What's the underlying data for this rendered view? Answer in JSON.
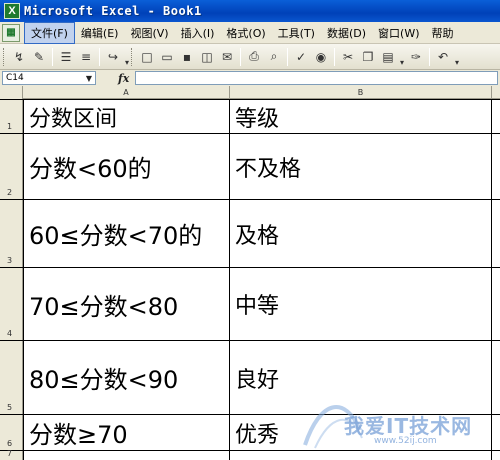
{
  "window": {
    "title": "Microsoft Excel - Book1"
  },
  "menubar": {
    "items": [
      "文件(F)",
      "编辑(E)",
      "视图(V)",
      "插入(I)",
      "格式(O)",
      "工具(T)",
      "数据(D)",
      "窗口(W)",
      "帮助"
    ]
  },
  "formula_bar": {
    "name_box": "C14",
    "fx_label": "fx",
    "formula": ""
  },
  "columns": [
    "A",
    "B"
  ],
  "rows": [
    {
      "num": "1",
      "a": "分数区间",
      "b": "等级"
    },
    {
      "num": "2",
      "a": "分数<60的",
      "b": "不及格"
    },
    {
      "num": "3",
      "a": "60≤分数<70的",
      "b": "及格"
    },
    {
      "num": "4",
      "a": "70≤分数<80",
      "b": "中等"
    },
    {
      "num": "5",
      "a": "80≤分数<90",
      "b": "良好"
    },
    {
      "num": "6",
      "a": "分数≥70",
      "b": "优秀"
    },
    {
      "num": "7",
      "a": "",
      "b": ""
    }
  ],
  "watermark": {
    "text": "我爱IT技术网",
    "url": "www.52ij.com"
  },
  "colors": {
    "titlebar": "#0041b8",
    "chrome": "#ece9d8",
    "grid_line": "#000000"
  }
}
